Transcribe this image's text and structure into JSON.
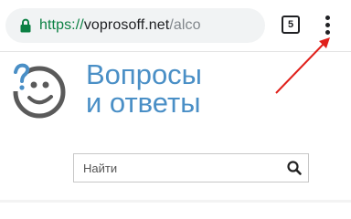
{
  "browser": {
    "url": {
      "scheme": "https://",
      "host": "voprosoff.net",
      "path": "/alco"
    },
    "tab_count": "5",
    "secure_color": "#0b8043"
  },
  "site": {
    "title_line1": "Вопросы",
    "title_line2": "и ответы",
    "title_color": "#4a8fc6",
    "logo_icon": "smiley-question-icon"
  },
  "search": {
    "placeholder": "Найти",
    "value": ""
  },
  "annotation": {
    "arrow_color": "#e0201b"
  }
}
